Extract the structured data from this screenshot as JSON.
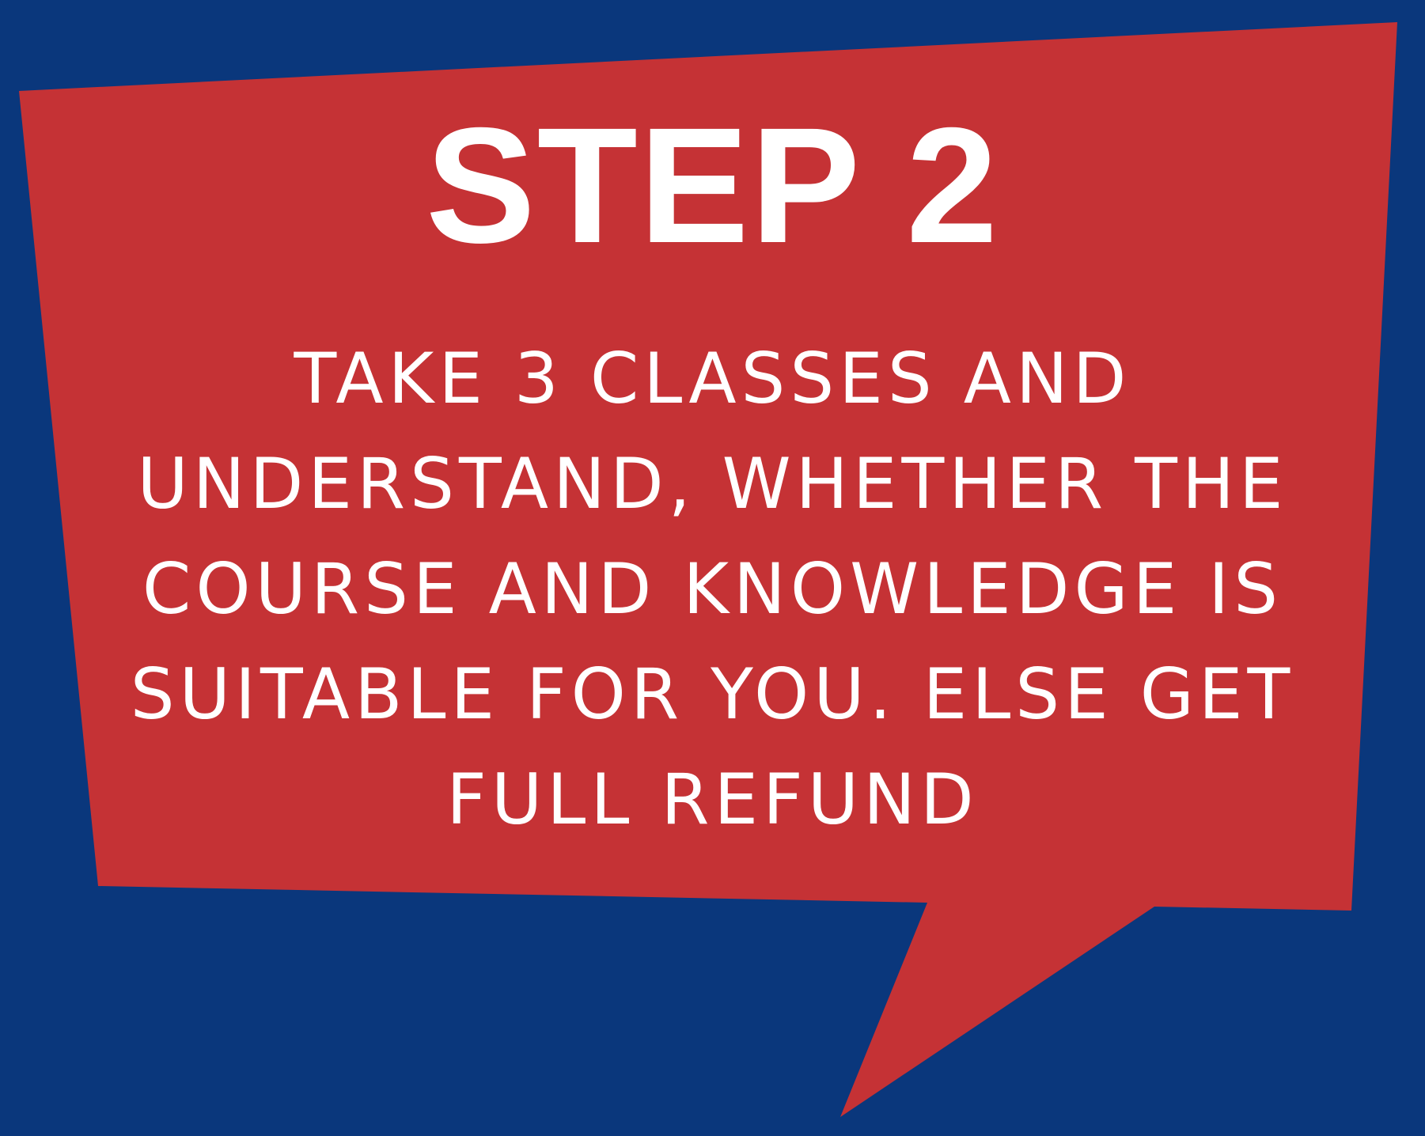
{
  "colors": {
    "background": "#0a377c",
    "bubble": "#c53235",
    "text": "#ffffff"
  },
  "heading": "STEP 2",
  "body_lines": [
    "TAKE 3 CLASSES AND",
    "UNDERSTAND, WHETHER THE",
    "COURSE AND KNOWLEDGE IS",
    "SUITABLE FOR YOU. ELSE GET",
    "FULL REFUND"
  ]
}
